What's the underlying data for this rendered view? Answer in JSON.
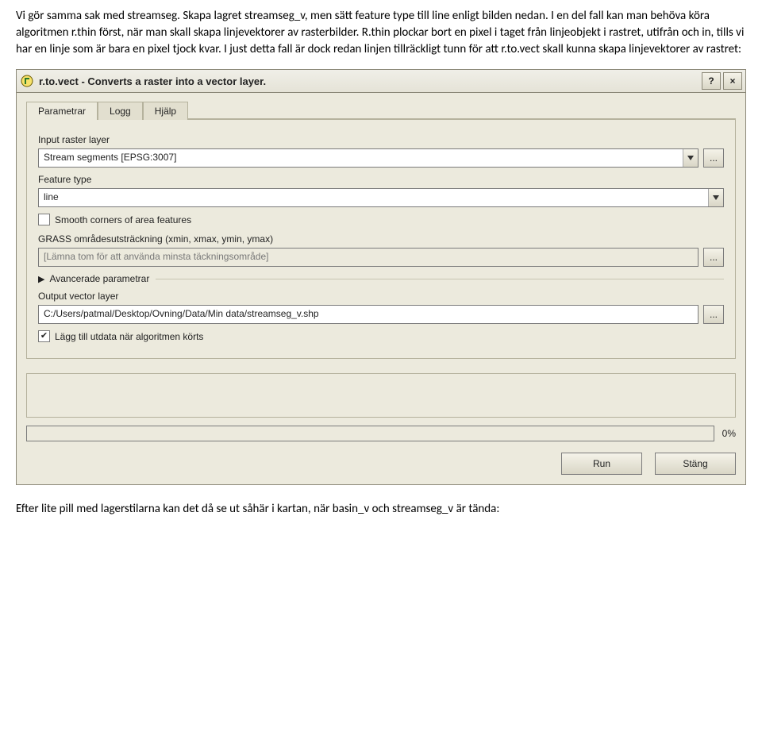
{
  "paragraphs": {
    "p1": "Vi gör samma sak med streamseg. Skapa lagret streamseg_v, men sätt feature type till line enligt bilden nedan. I en del fall kan man behöva köra algoritmen r.thin först, när man skall skapa linjevektorer av rasterbilder. R.thin plockar bort en pixel i taget från linjeobjekt i rastret, utifrån och in, tills vi har en linje som är bara en pixel tjock kvar. I just detta fall är dock redan linjen tillräckligt tunn för att r.to.vect skall kunna skapa linjevektorer av rastret:",
    "p2": "Efter lite pill med lagerstilarna kan det då se ut såhär i kartan, när basin_v och streamseg_v är tända:"
  },
  "dialog": {
    "title": "r.to.vect - Converts a raster into a vector layer.",
    "help_btn": "?",
    "close_btn": "×",
    "tabs": {
      "parametrar": "Parametrar",
      "logg": "Logg",
      "hjalp": "Hjälp"
    },
    "labels": {
      "input_raster": "Input raster layer",
      "feature_type": "Feature type",
      "smooth": "Smooth corners of area features",
      "extent": "GRASS områdesutsträckning (xmin, xmax, ymin, ymax)",
      "advanced": "Avancerade parametrar",
      "output": "Output vector layer",
      "add_output": "Lägg till utdata när algoritmen körts"
    },
    "values": {
      "input_raster": "Stream segments [EPSG:3007]",
      "feature_type": "line",
      "extent_placeholder": "[Lämna tom för att använda minsta täckningsområde]",
      "output": "C:/Users/patmal/Desktop/Ovning/Data/Min data/streamseg_v.shp"
    },
    "browse": "...",
    "progress_pct": "0%",
    "buttons": {
      "run": "Run",
      "close": "Stäng"
    }
  }
}
